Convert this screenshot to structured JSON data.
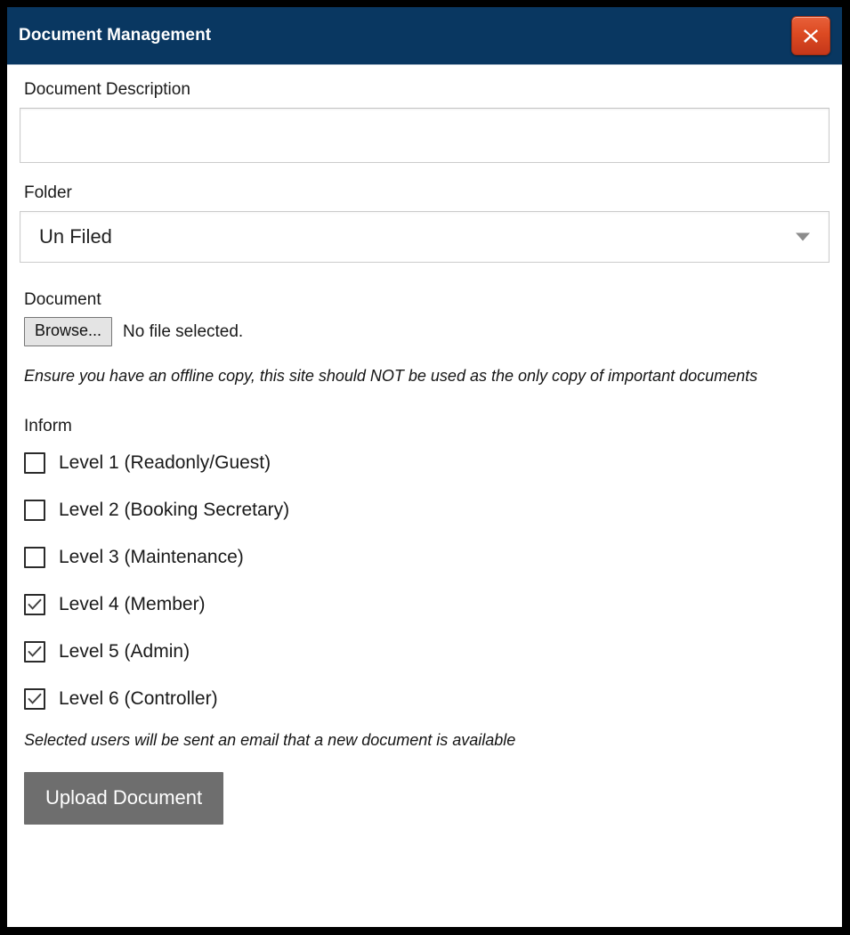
{
  "titlebar": {
    "title": "Document Management",
    "close_icon": "close-x-icon",
    "background_color": "#093761",
    "close_button_color": "#dc4a22"
  },
  "form": {
    "description": {
      "label": "Document Description",
      "value": "",
      "placeholder": ""
    },
    "folder": {
      "label": "Folder",
      "selected": "Un Filed",
      "arrow_icon": "chevron-down-icon"
    },
    "document": {
      "label": "Document",
      "browse_label": "Browse...",
      "file_status": "No file selected.",
      "warning_note": "Ensure you have an offline copy, this site should NOT be used as the only copy of important documents"
    },
    "inform": {
      "label": "Inform",
      "options": [
        {
          "label": "Level 1 (Readonly/Guest)",
          "checked": false
        },
        {
          "label": "Level 2 (Booking Secretary)",
          "checked": false
        },
        {
          "label": "Level 3 (Maintenance)",
          "checked": false
        },
        {
          "label": "Level 4 (Member)",
          "checked": true
        },
        {
          "label": "Level 5 (Admin)",
          "checked": true
        },
        {
          "label": "Level 6 (Controller)",
          "checked": true
        }
      ],
      "email_note": "Selected users will be sent an email that a new document is available"
    },
    "submit": {
      "label": "Upload Document",
      "color": "#6e6e6e"
    }
  }
}
